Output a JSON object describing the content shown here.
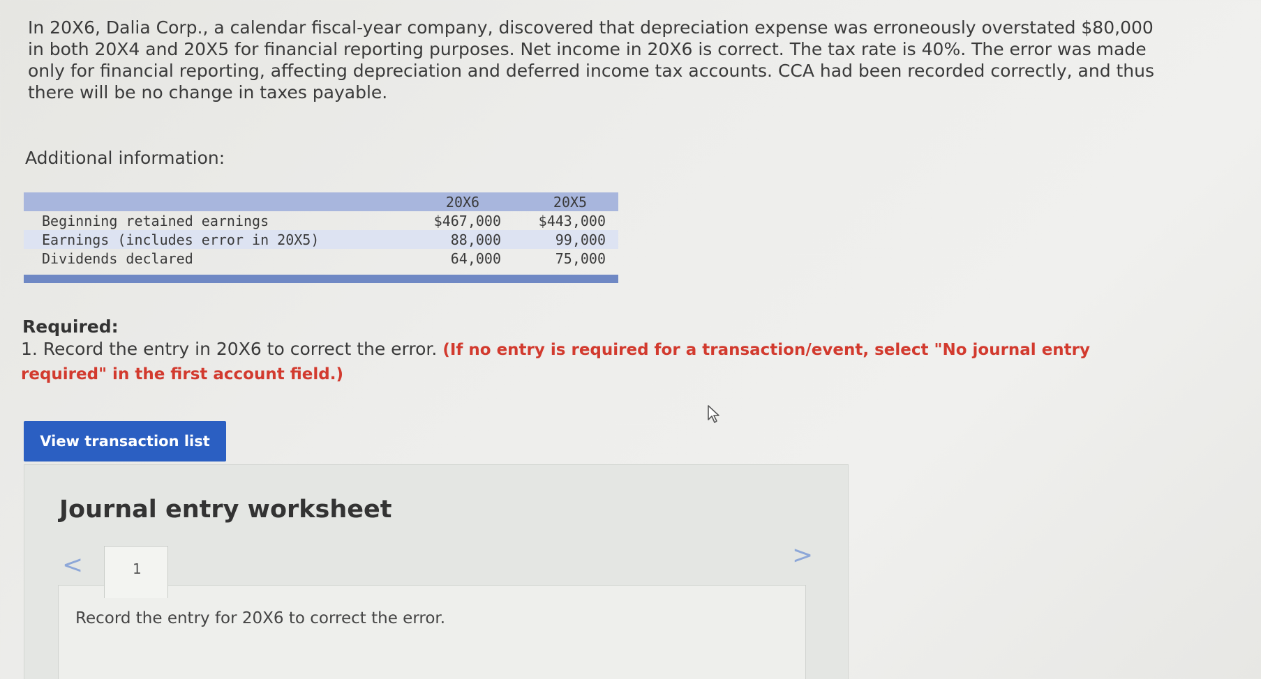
{
  "problem": {
    "text": "In 20X6, Dalia Corp., a calendar fiscal-year company, discovered that depreciation expense was erroneously overstated $80,000 in both 20X4 and 20X5 for financial reporting purposes. Net income in 20X6 is correct. The tax rate is 40%. The error was made only for financial reporting, affecting depreciation and deferred income tax accounts. CCA had been recorded correctly, and thus there will be no change in taxes payable."
  },
  "additional": {
    "label": "Additional information:"
  },
  "table": {
    "headers": [
      "20X6",
      "20X5"
    ],
    "rows": [
      {
        "label": "Beginning retained earnings",
        "v1": "$467,000",
        "v2": "$443,000"
      },
      {
        "label": "Earnings (includes error in 20X5)",
        "v1": "88,000",
        "v2": "99,000"
      },
      {
        "label": "Dividends declared",
        "v1": "64,000",
        "v2": "75,000"
      }
    ]
  },
  "required": {
    "label": "Required:",
    "item": "1. Record the entry in 20X6 to correct the error.",
    "instruction": "(If no entry is required for a transaction/event, select \"No journal entry required\" in the first account field.)"
  },
  "buttons": {
    "view_transactions": "View transaction list"
  },
  "worksheet": {
    "title": "Journal entry worksheet",
    "prev": "<",
    "next": ">",
    "tab_number": "1",
    "panel_text": "Record the entry for 20X6 to correct the error."
  },
  "icons": {
    "cursor": "mouse-pointer-icon"
  },
  "colors": {
    "button_bg": "#2b5fc2",
    "instruction": "#d23a2e",
    "table_header": "#a8b6dd",
    "table_footer": "#6f88c4",
    "nav_arrow": "#8da7d8"
  }
}
